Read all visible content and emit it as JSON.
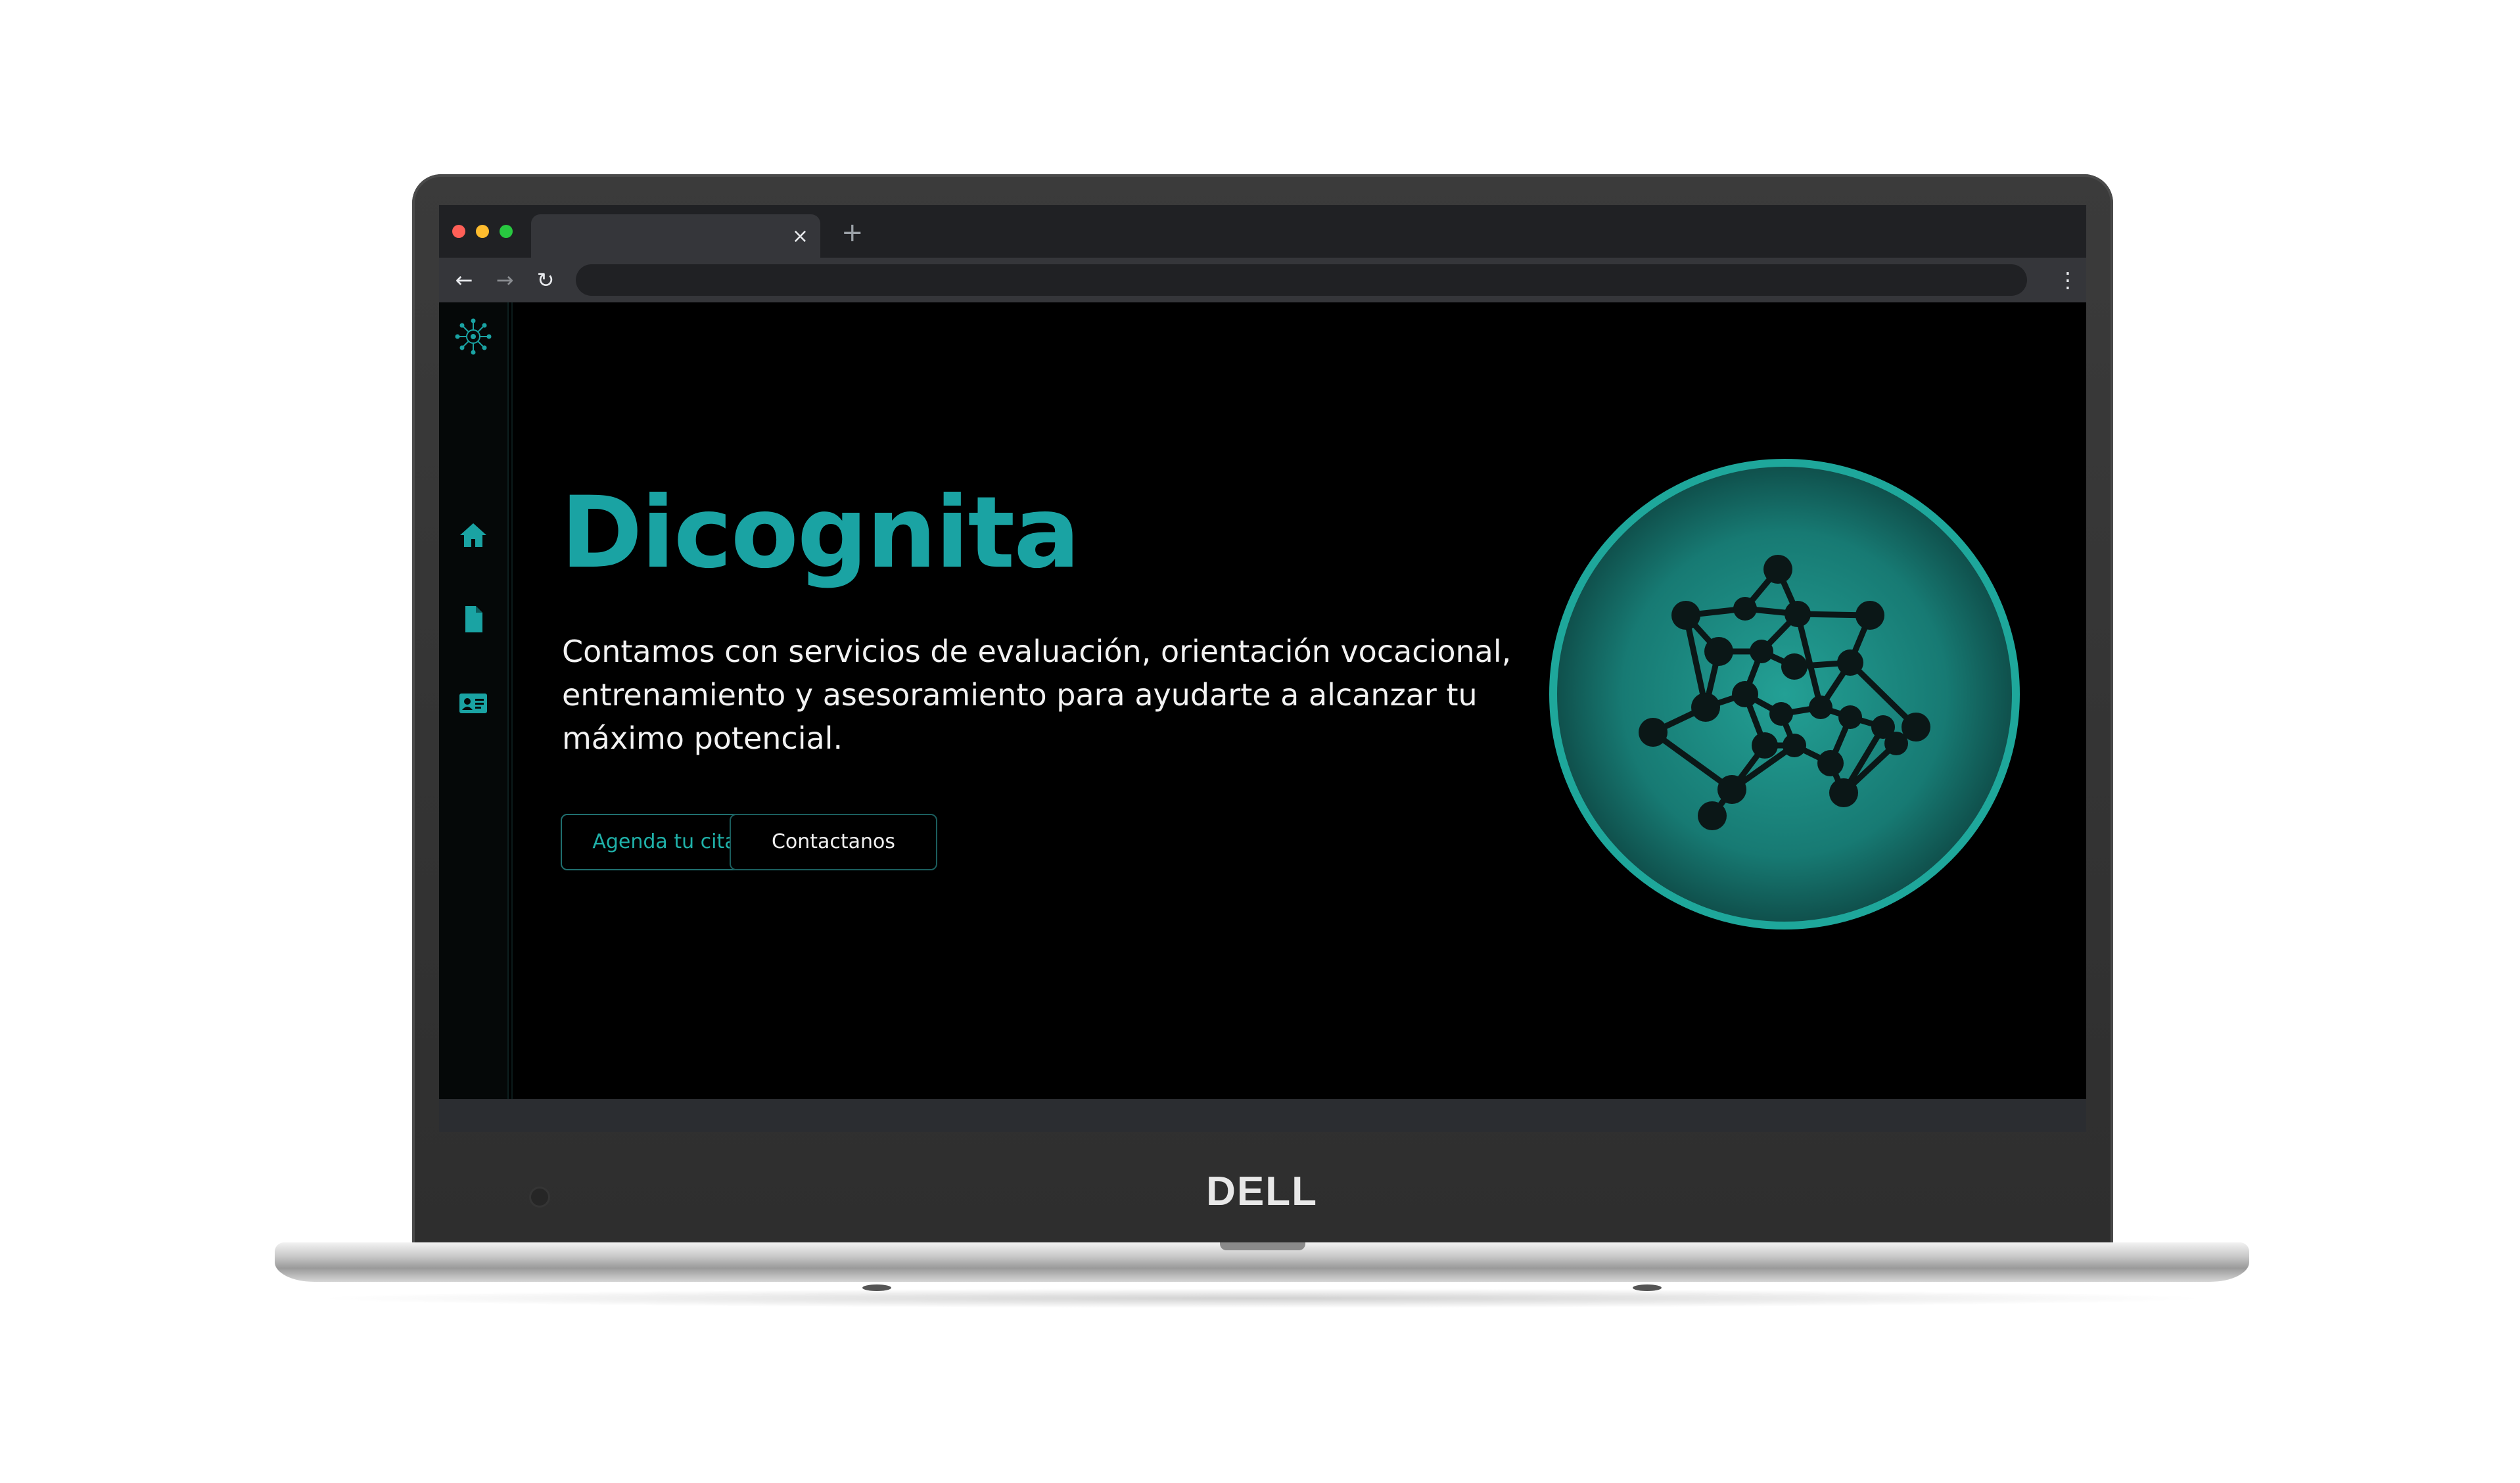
{
  "device": {
    "brand_logo": "DELL"
  },
  "browser": {
    "tab_close": "×",
    "new_tab": "+",
    "back": "←",
    "forward": "→",
    "reload": "↻",
    "menu": "⋮",
    "window_controls": [
      "close-dot",
      "minimize-dot",
      "maximize-dot"
    ]
  },
  "sidebar": {
    "logo": "neural-network-icon",
    "items": [
      {
        "icon": "home-icon"
      },
      {
        "icon": "document-icon"
      },
      {
        "icon": "contact-card-icon"
      }
    ]
  },
  "hero": {
    "title": "Dicognita",
    "description": "Contamos con servicios de evaluación, orientación vocacional, entrenamiento y asesoramiento para ayudarte a alcanzar tu máximo potencial.",
    "primary_button": "Agenda tu cita",
    "secondary_button": "Contactanos",
    "illustration": "molecule-network-icon"
  },
  "colors": {
    "accent": "#1aa3a3",
    "background": "#000000",
    "circle_border": "#1ea79b",
    "circle_fill": "#1c8a83"
  }
}
